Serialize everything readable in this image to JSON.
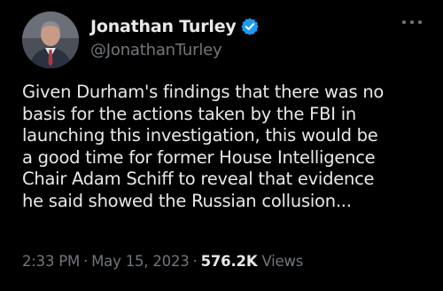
{
  "author": {
    "display_name": "Jonathan Turley",
    "handle": "@JonathanTurley",
    "verified_icon": "verified-badge-icon",
    "verified_color": "#1d9bf0"
  },
  "tweet": {
    "lines": [
      "Given Durham's findings that there was no",
      "basis for the actions taken by the FBI in",
      "launching this investigation, this would be",
      "a good time for former House Intelligence",
      "Chair Adam Schiff to reveal that evidence",
      "he said showed the Russian collusion..."
    ]
  },
  "meta": {
    "time": "2:33 PM",
    "separator": "·",
    "date": "May 15, 2023",
    "views_count": "576.2K",
    "views_label": "Views"
  },
  "colors": {
    "background": "#000000",
    "text": "#e7e9ea",
    "muted": "#71767b"
  }
}
